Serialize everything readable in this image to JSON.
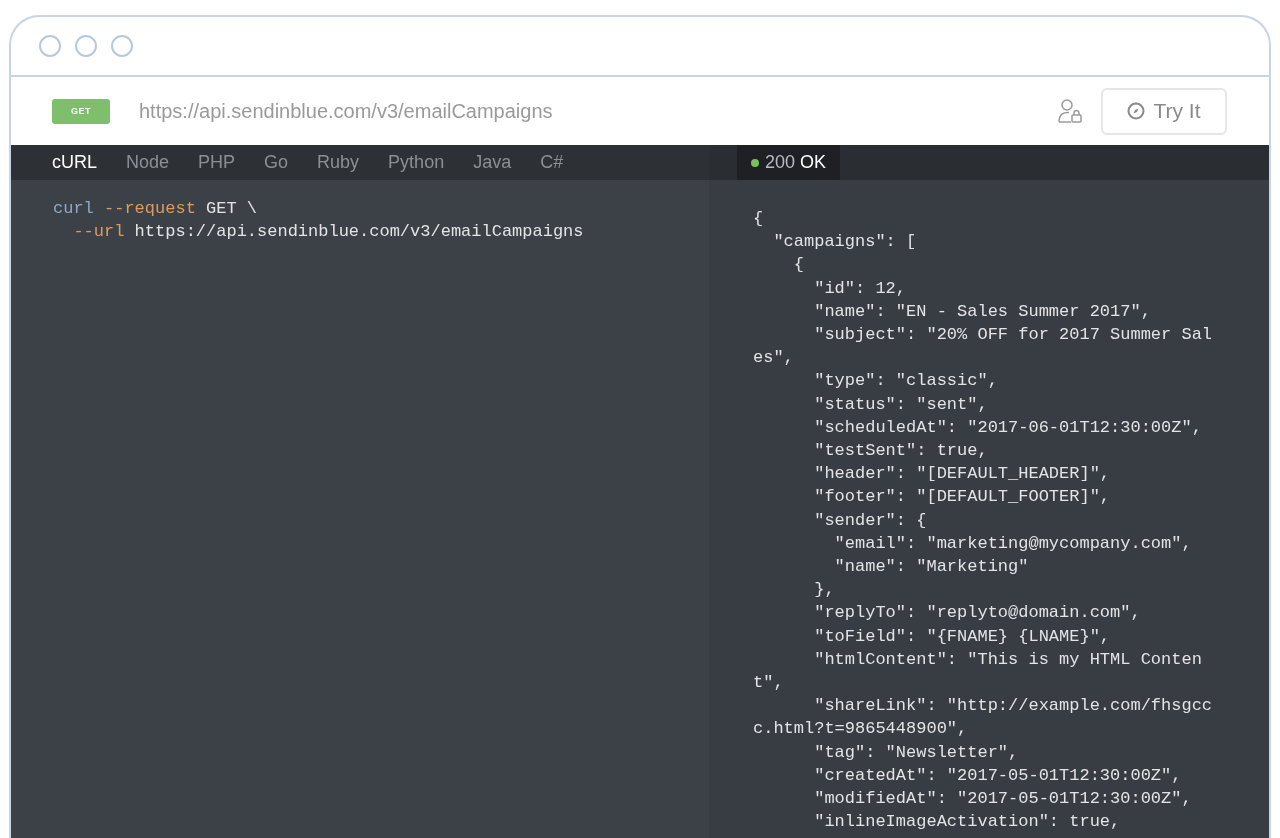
{
  "request": {
    "method": "GET",
    "url": "https://api.sendinblue.com/v3/emailCampaigns",
    "try_button": "Try It"
  },
  "tabs": [
    {
      "label": "cURL",
      "selected": true
    },
    {
      "label": "Node",
      "selected": false
    },
    {
      "label": "PHP",
      "selected": false
    },
    {
      "label": "Go",
      "selected": false
    },
    {
      "label": "Ruby",
      "selected": false
    },
    {
      "label": "Python",
      "selected": false
    },
    {
      "label": "Java",
      "selected": false
    },
    {
      "label": "C#",
      "selected": false
    }
  ],
  "request_code": [
    [
      {
        "text": "curl",
        "kind": "command"
      },
      {
        "text": " --request",
        "kind": "flag"
      },
      {
        "text": " GET \\",
        "kind": "plain"
      }
    ],
    [
      {
        "text": "  --url",
        "kind": "flag"
      },
      {
        "text": " https://api.sendinblue.com/v3/emailCampaigns",
        "kind": "plain"
      }
    ]
  ],
  "response": {
    "status_code": "200",
    "status_text": "OK",
    "color": "#7cc05c",
    "lines": [
      "{",
      "  \"campaigns\": [",
      "    {",
      "      \"id\": 12,",
      "      \"name\": \"EN - Sales Summer 2017\",",
      "      \"subject\": \"20% OFF for 2017 Summer Sal",
      "es\",",
      "      \"type\": \"classic\",",
      "      \"status\": \"sent\",",
      "      \"scheduledAt\": \"2017-06-01T12:30:00Z\",",
      "      \"testSent\": true,",
      "      \"header\": \"[DEFAULT_HEADER]\",",
      "      \"footer\": \"[DEFAULT_FOOTER]\",",
      "      \"sender\": {",
      "        \"email\": \"marketing@mycompany.com\",",
      "        \"name\": \"Marketing\"",
      "      },",
      "      \"replyTo\": \"replyto@domain.com\",",
      "      \"toField\": \"{FNAME} {LNAME}\",",
      "      \"htmlContent\": \"This is my HTML Conten",
      "t\",",
      "      \"shareLink\": \"http://example.com/fhsgcc",
      "c.html?t=9865448900\",",
      "      \"tag\": \"Newsletter\",",
      "      \"createdAt\": \"2017-05-01T12:30:00Z\",",
      "      \"modifiedAt\": \"2017-05-01T12:30:00Z\",",
      "      \"inlineImageActivation\": true,"
    ]
  }
}
